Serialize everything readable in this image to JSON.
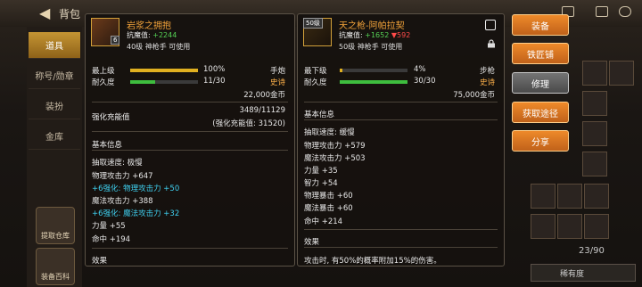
{
  "topbar": {
    "title": "背包"
  },
  "nav": {
    "tabs": [
      "道具",
      "称号/勋章",
      "装扮",
      "金库"
    ],
    "icons": [
      {
        "label": "提取仓库"
      },
      {
        "label": "装备百科"
      }
    ]
  },
  "left_item": {
    "name": "岩浆之拥抱",
    "atk_label": "抗魔值:",
    "atk_value": "+2244",
    "level": "40级 神枪手 可使用",
    "badge": "6",
    "grade_label": "最上级",
    "grade_pct": "100%",
    "grade_fraction": 1.0,
    "type": "手炮",
    "dur_label": "耐久度",
    "dur_value": "11/30",
    "dur_fraction": 0.3667,
    "rarity": "史诗",
    "price": "22,000金币",
    "enh_label": "强化充能值",
    "enh_value": "3489/11129",
    "enh_sub": "(强化充能值: 31520)",
    "basic_title": "基本信息",
    "stats": [
      {
        "text": "抽取速度: 极慢",
        "cyan": false
      },
      {
        "text": "物理攻击力 +647",
        "cyan": false
      },
      {
        "text": "+6强化: 物理攻击力 +50",
        "cyan": true
      },
      {
        "text": "魔法攻击力 +388",
        "cyan": false
      },
      {
        "text": "+6强化: 魔法攻击力 +32",
        "cyan": true
      },
      {
        "text": "力量 +55",
        "cyan": false
      },
      {
        "text": "命中 +194",
        "cyan": false
      }
    ],
    "effect_title": "效果"
  },
  "right_item": {
    "badge": "50级",
    "name": "天之枪-阿帕拉契",
    "atk_label": "抗魔值:",
    "atk_value": "+1652",
    "atk_diff": "▼592",
    "level": "50级 神枪手 可使用",
    "grade_label": "最下级",
    "grade_pct": "4%",
    "grade_fraction": 0.04,
    "type": "步枪",
    "dur_label": "耐久度",
    "dur_value": "30/30",
    "dur_fraction": 1.0,
    "rarity": "史诗",
    "price": "75,000金币",
    "basic_title": "基本信息",
    "stats": [
      {
        "text": "抽取速度: 缓慢"
      },
      {
        "text": "物理攻击力 +579"
      },
      {
        "text": "魔法攻击力 +503"
      },
      {
        "text": "力量 +35"
      },
      {
        "text": "智力 +54"
      },
      {
        "text": "物理暴击 +60"
      },
      {
        "text": "魔法暴击 +60"
      },
      {
        "text": "命中 +214"
      }
    ],
    "effect_title": "效果",
    "effect_text": "攻击时, 有50%的概率附加15%的伤害。"
  },
  "actions": [
    {
      "label": "装备",
      "style": "orange"
    },
    {
      "label": "铁匠铺",
      "style": "orange"
    },
    {
      "label": "修理",
      "style": "grey"
    },
    {
      "label": "获取途径",
      "style": "orange"
    },
    {
      "label": "分享",
      "style": "orange"
    }
  ],
  "inventory": {
    "count": "23/90",
    "sort_label": "稀有度"
  },
  "colors": {
    "epic": "#ffb14a",
    "gold_bar": "#e0b020",
    "green_bar": "#3ebd3e",
    "enhance": "#3fd0f0"
  }
}
